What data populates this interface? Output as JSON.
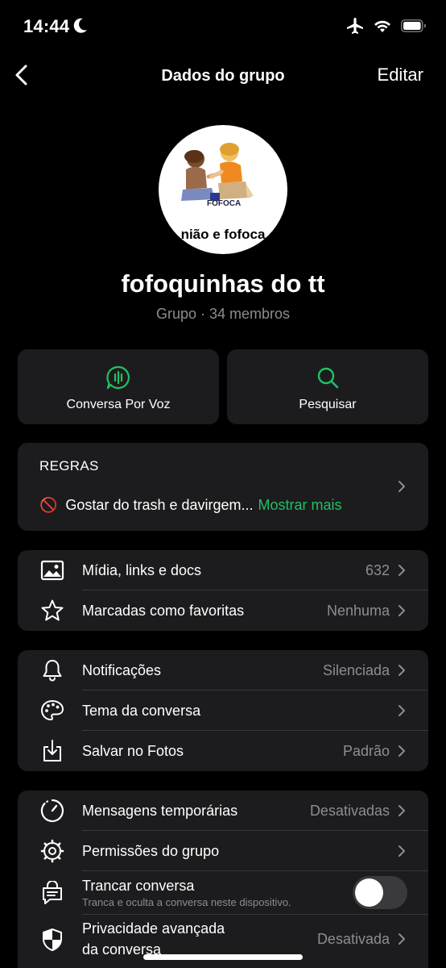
{
  "status_bar": {
    "time": "14:44"
  },
  "nav": {
    "title": "Dados do grupo",
    "edit_label": "Editar"
  },
  "group": {
    "avatar_caption": "nião e fofoca",
    "avatar_small": "FOFOCA",
    "name": "fofoquinhas do tt",
    "subtitle": "Grupo · 34 membros"
  },
  "actions": [
    {
      "label": "Conversa Por Voz",
      "icon": "voice-chat-icon"
    },
    {
      "label": "Pesquisar",
      "icon": "search-icon"
    }
  ],
  "rules": {
    "title": "REGRAS",
    "emoji": "🚫",
    "text": "Gostar do trash e davirgem...",
    "show_more": "Mostrar mais"
  },
  "media_section": [
    {
      "label": "Mídia, links e docs",
      "value": "632",
      "icon": "image-icon"
    },
    {
      "label": "Marcadas como favoritas",
      "value": "Nenhuma",
      "icon": "star-icon"
    }
  ],
  "settings_section": [
    {
      "label": "Notificações",
      "value": "Silenciada",
      "icon": "bell-icon"
    },
    {
      "label": "Tema da conversa",
      "value": "",
      "icon": "palette-icon"
    },
    {
      "label": "Salvar no Fotos",
      "value": "Padrão",
      "icon": "download-icon"
    }
  ],
  "privacy_section": {
    "disappearing": {
      "label": "Mensagens temporárias",
      "value": "Desativadas",
      "icon": "timer-icon"
    },
    "permissions": {
      "label": "Permissões do grupo",
      "value": "",
      "icon": "gear-icon"
    },
    "lock": {
      "label": "Trancar conversa",
      "sub": "Tranca e oculta a conversa neste dispositivo.",
      "icon": "lock-chat-icon",
      "enabled": false
    },
    "advanced": {
      "label_line1": "Privacidade avançada",
      "label_line2": "da conversa",
      "value": "Desativada",
      "icon": "shield-icon"
    }
  },
  "colors": {
    "accent": "#21c063",
    "card": "#1c1c1e",
    "secondary_text": "#8d8d92"
  }
}
